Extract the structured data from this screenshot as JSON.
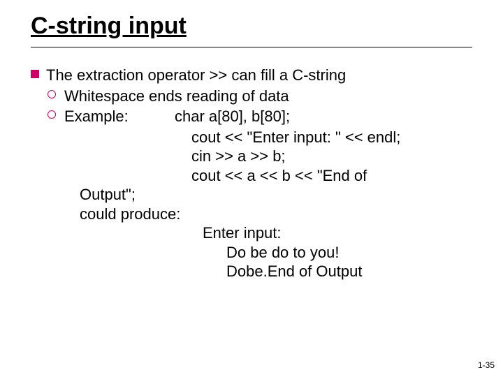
{
  "title": "C-string input",
  "bullets": {
    "main": "The extraction operator  >> can fill a C-string",
    "sub1": "Whitespace ends reading of data",
    "sub2_label": "Example:",
    "code1": "char a[80], b[80];",
    "code2": "cout << \"Enter input: \" << endl;",
    "code3": "cin >> a  >> b;",
    "code4": "cout << a << b << \"End of",
    "cont1": "Output\";",
    "cont2": "could produce:",
    "out1": "Enter input:",
    "out2": "Do be do to you!",
    "out3": "Dobe.End of Output"
  },
  "footer": "1-35"
}
